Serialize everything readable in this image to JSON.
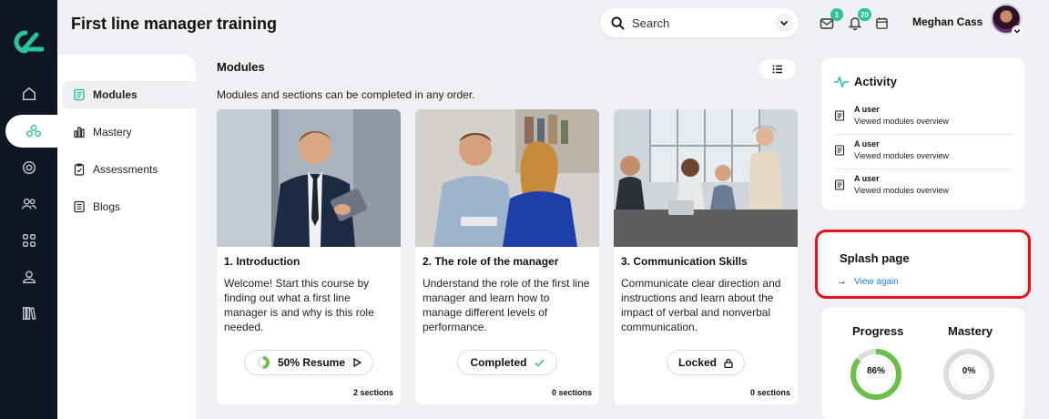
{
  "app": {
    "title": "First line manager training"
  },
  "search": {
    "placeholder": "Search"
  },
  "header": {
    "inbox_badge": "1",
    "notifications_badge": "20",
    "user_name": "Meghan Cass"
  },
  "rail": {
    "items": [
      {
        "icon": "home-icon"
      },
      {
        "icon": "modules-icon",
        "active": true
      },
      {
        "icon": "target-icon"
      },
      {
        "icon": "users-icon"
      },
      {
        "icon": "grid-icon"
      },
      {
        "icon": "person-icon"
      },
      {
        "icon": "library-icon"
      }
    ]
  },
  "subnav": {
    "items": [
      {
        "label": "Modules",
        "icon": "book-icon",
        "active": true
      },
      {
        "label": "Mastery",
        "icon": "bar-chart-icon"
      },
      {
        "label": "Assessments",
        "icon": "clipboard-icon"
      },
      {
        "label": "Blogs",
        "icon": "document-icon"
      }
    ]
  },
  "main": {
    "title": "Modules",
    "subtitle": "Modules and sections can be completed in any order."
  },
  "modules": [
    {
      "title": "1. Introduction",
      "description": "Welcome! Start this course by finding out what a first line manager is and why is this role needed.",
      "button": "50% Resume",
      "progress": 0.5,
      "sections": "2 sections"
    },
    {
      "title": "2. The role of the manager",
      "description": "Understand the role of the first line manager and learn how to manage different levels of performance.",
      "button": "Completed",
      "sections": "0 sections"
    },
    {
      "title": "3. Communication Skills",
      "description": "Communicate clear direction and instructions and learn about the impact of verbal and nonverbal communication.",
      "button": "Locked",
      "sections": "0 sections"
    }
  ],
  "activity": {
    "title": "Activity",
    "items": [
      {
        "user": "A user",
        "action": "Viewed modules overview"
      },
      {
        "user": "A user",
        "action": "Viewed modules overview"
      },
      {
        "user": "A user",
        "action": "Viewed modules overview"
      }
    ]
  },
  "splash": {
    "title": "Splash page",
    "link": "View again"
  },
  "metrics": {
    "progress_label": "Progress",
    "progress_value": "86%",
    "progress_fraction": 0.86,
    "mastery_label": "Mastery",
    "mastery_value": "0%",
    "mastery_fraction": 0
  },
  "colors": {
    "accent": "#2bc39a",
    "rail": "#0f1623",
    "progress_ring": "#6cc04a",
    "link": "#1f7ad6",
    "highlight": "#e4141c"
  }
}
